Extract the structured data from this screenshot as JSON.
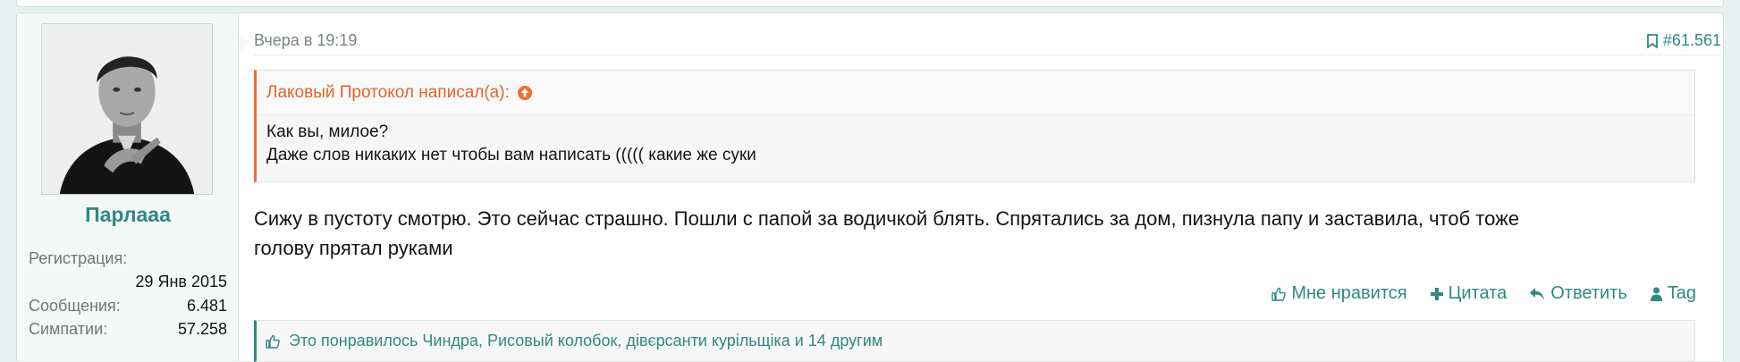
{
  "user": {
    "username": "Парлааа",
    "registration_label": "Регистрация:",
    "registration_date": "29 Янв 2015",
    "messages_label": "Сообщения:",
    "messages_value": "6.481",
    "likes_label": "Симпатии:",
    "likes_value": "57.258"
  },
  "post": {
    "date": "Вчера в 19:19",
    "number": "#61.561",
    "quote": {
      "author_line": "Лаковый Протокол написал(а):",
      "lines": [
        "Как вы, милое?",
        "Даже слов никаких нет чтобы вам написать ((((( какие же суки"
      ]
    },
    "message_lines": [
      "Сижу в пустоту смотрю. Это сейчас страшно. Пошли с папой за водичкой блять. Спрятались за дом, пизнула папу и заставила, чтоб тоже",
      "голову прятал руками"
    ],
    "actions": {
      "like": "Мне нравится",
      "quote": "Цитата",
      "reply": "Ответить",
      "tag": "Tag"
    },
    "likes_summary": "Это понравилось Чиндра, Рисовый колобок, дівєрсанти курільщіка и 14 другим"
  },
  "colors": {
    "accent": "#2f8a80",
    "quote_accent": "#e9702e"
  },
  "icons": [
    "bookmark-icon",
    "arrow-up-circle-icon",
    "thumbs-up-icon",
    "plus-icon",
    "reply-icon",
    "user-icon"
  ]
}
